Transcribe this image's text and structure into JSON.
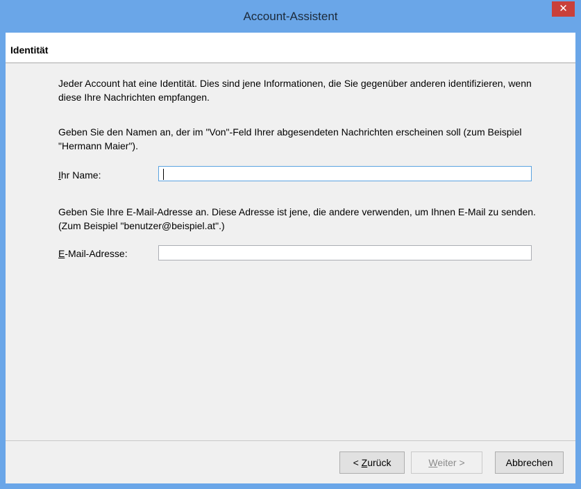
{
  "window": {
    "title": "Account-Assistent",
    "close_glyph": "✕"
  },
  "page": {
    "heading": "Identität"
  },
  "body": {
    "intro": "Jeder Account hat eine Identität. Dies sind jene Informationen, die Sie gegenüber anderen identifizieren, wenn diese Ihre Nachrichten empfangen.",
    "name_hint": "Geben Sie den Namen an, der im \"Von\"-Feld Ihrer abgesendeten Nachrichten erscheinen soll (zum Beispiel \"Hermann Maier\").",
    "email_hint": "Geben Sie Ihre E-Mail-Adresse an. Diese Adresse ist jene, die andere verwenden, um Ihnen E-Mail zu senden. (Zum Beispiel \"benutzer@beispiel.at\".)"
  },
  "form": {
    "name_label_mnemonic": "I",
    "name_label_rest": "hr Name:",
    "name_value": "",
    "email_label_mnemonic": "E",
    "email_label_rest": "-Mail-Adresse:",
    "email_value": ""
  },
  "buttons": {
    "back_prefix": "< ",
    "back_mnemonic": "Z",
    "back_rest": "urück",
    "next_mnemonic": "W",
    "next_rest": "eiter >",
    "next_enabled": false,
    "cancel": "Abbrechen"
  },
  "colors": {
    "titlebar": "#6aa6e8",
    "close": "#c9403a",
    "panel": "#f0f0f0"
  }
}
